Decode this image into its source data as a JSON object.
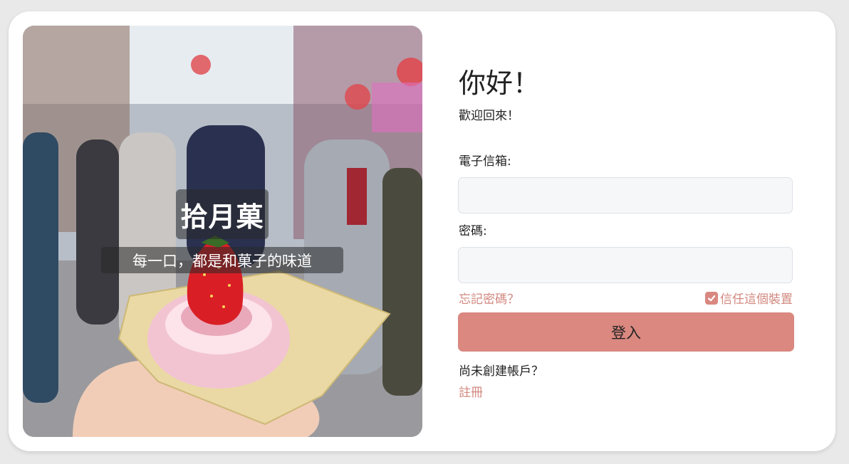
{
  "hero": {
    "title": "拾月菓",
    "subtitle": "每一口，都是和菓子的味道"
  },
  "login": {
    "greeting": "你好！",
    "welcome": "歡迎回來！",
    "email_label": "電子信箱:",
    "email_value": "",
    "password_label": "密碼:",
    "password_value": "",
    "forgot_password": "忘記密碼？",
    "trust_device": "信任這個裝置",
    "trust_device_checked": true,
    "submit_label": "登入",
    "no_account_text": "尚未創建帳戶？",
    "register_link": "註冊"
  },
  "colors": {
    "accent": "#da8880",
    "link": "#d2877e",
    "input_bg": "#f6f7f9",
    "page_bg": "#e9e9e9"
  }
}
